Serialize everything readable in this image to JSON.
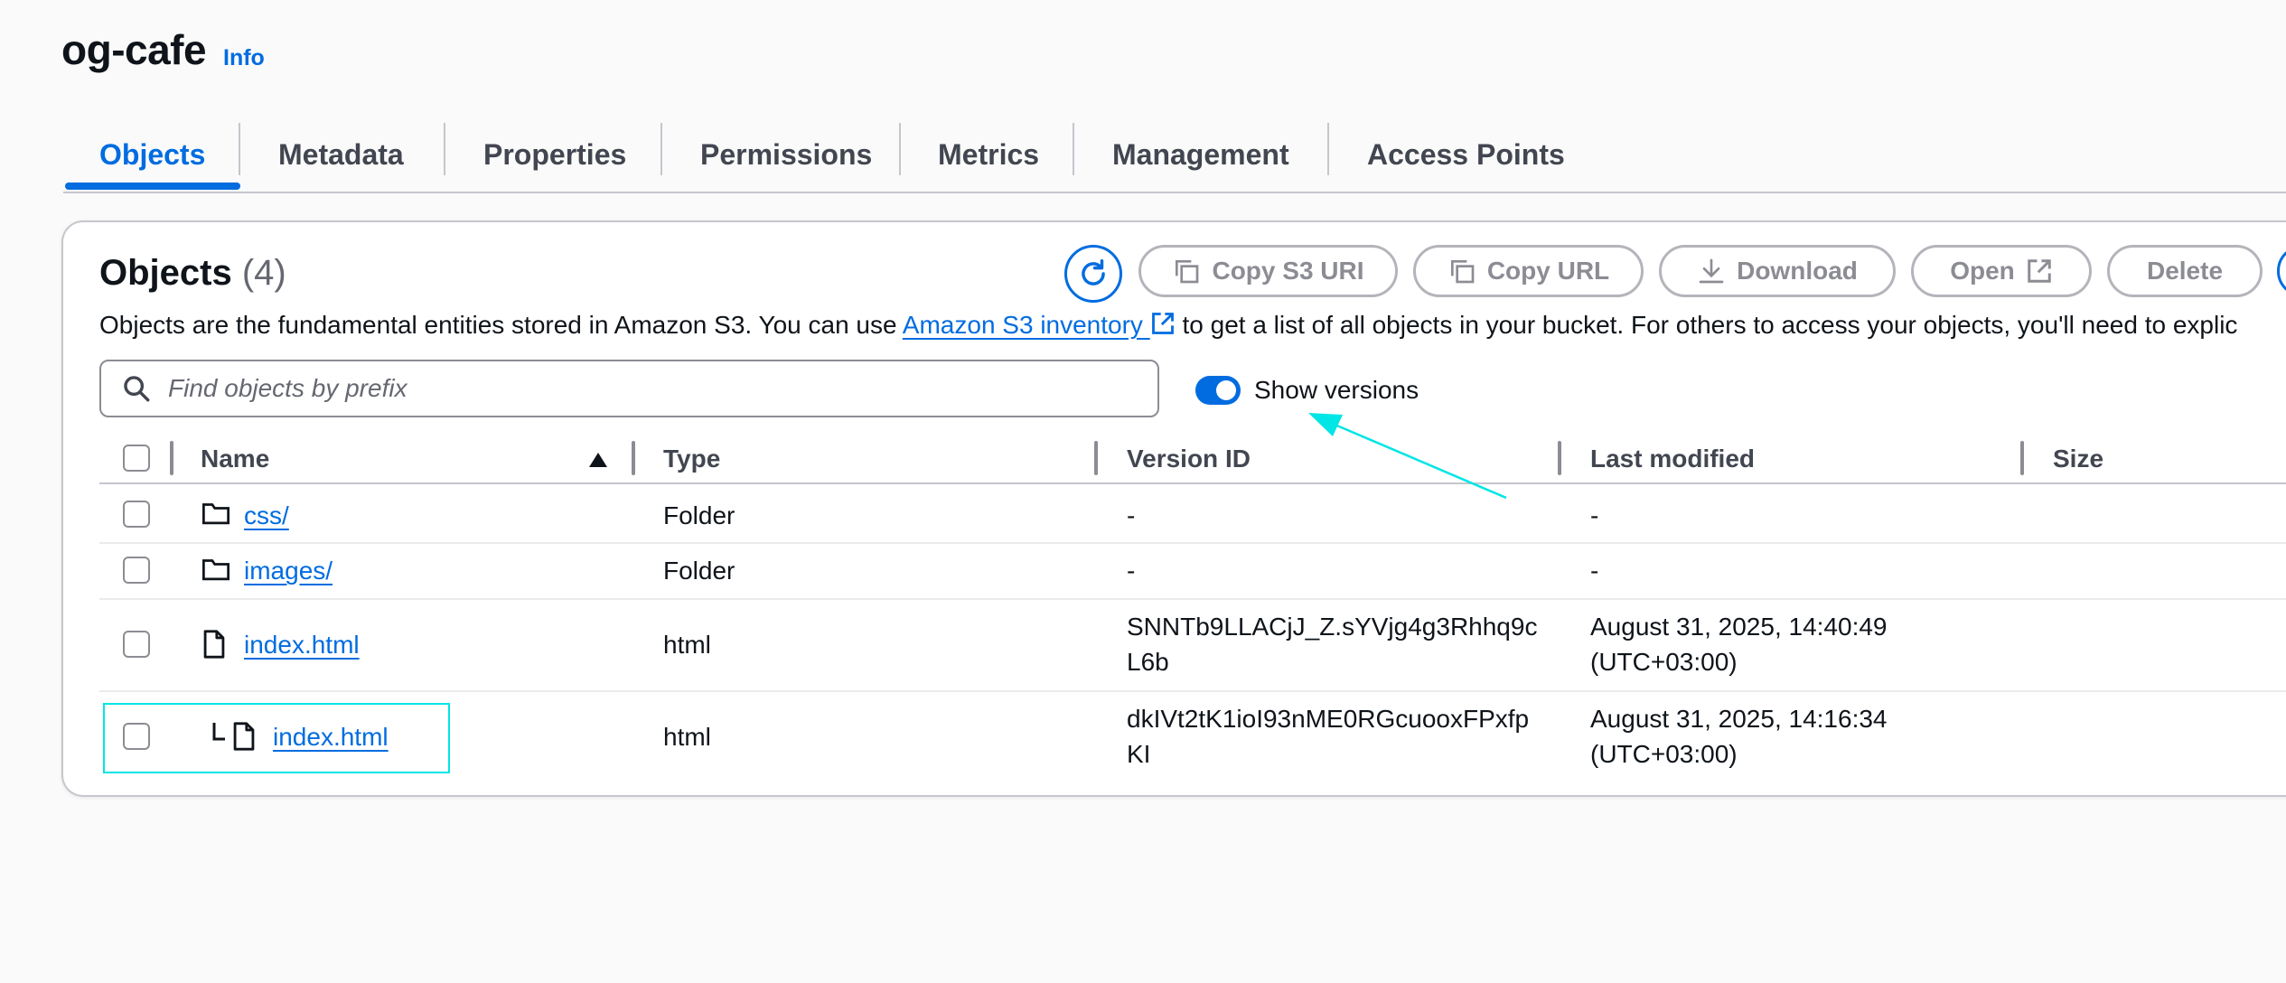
{
  "header": {
    "bucket_name": "og-cafe",
    "info_label": "Info"
  },
  "tabs": [
    {
      "label": "Objects",
      "active": true
    },
    {
      "label": "Metadata"
    },
    {
      "label": "Properties"
    },
    {
      "label": "Permissions"
    },
    {
      "label": "Metrics"
    },
    {
      "label": "Management"
    },
    {
      "label": "Access Points"
    }
  ],
  "objects_panel": {
    "title": "Objects",
    "count": "(4)",
    "description_prefix": "Objects are the fundamental entities stored in Amazon S3. You can use ",
    "description_link": "Amazon S3 inventory",
    "description_suffix": " to get a list of all objects in your bucket. For others to access your objects, you'll need to explic"
  },
  "toolbar": {
    "copy_s3_uri": "Copy S3 URI",
    "copy_url": "Copy URL",
    "download": "Download",
    "open": "Open",
    "delete": "Delete"
  },
  "search": {
    "placeholder": "Find objects by prefix"
  },
  "show_versions": {
    "label": "Show versions",
    "enabled": true
  },
  "table": {
    "columns": [
      "Name",
      "Type",
      "Version ID",
      "Last modified",
      "Size"
    ],
    "rows": [
      {
        "name": "css/",
        "type": "Folder",
        "version_id": "-",
        "last_modified": "-"
      },
      {
        "name": "images/",
        "type": "Folder",
        "version_id": "-",
        "last_modified": "-"
      },
      {
        "name": "index.html",
        "type": "html",
        "version_id_1": "SNNTb9LLACjJ_Z.sYVjg4g3Rhhq9c",
        "version_id_2": "L6b",
        "last_modified_1": "August 31, 2025, 14:40:49",
        "last_modified_2": "(UTC+03:00)"
      },
      {
        "name": "index.html",
        "type": "html",
        "version_id_1": "dkIVt2tK1ioI93nME0RGcuooxFPxfp",
        "version_id_2": "KI",
        "last_modified_1": "August 31, 2025, 14:16:34",
        "last_modified_2": "(UTC+03:00)"
      }
    ]
  },
  "colors": {
    "accent": "#006ce0",
    "annotation": "#00e5e5"
  },
  "icons": [
    "refresh-icon",
    "copy-icon",
    "download-icon",
    "external-link-icon",
    "search-icon",
    "folder-icon",
    "file-icon",
    "sort-ascending-icon"
  ]
}
